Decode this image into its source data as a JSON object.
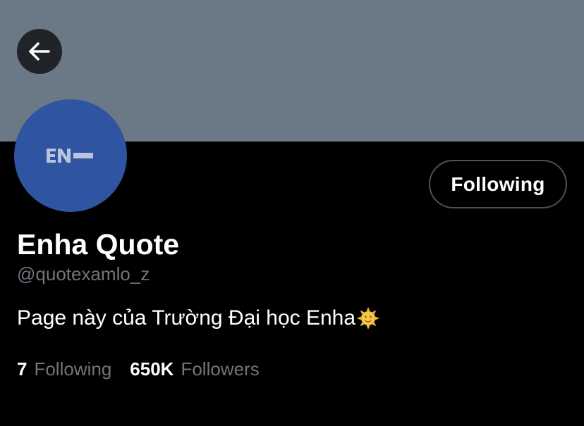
{
  "profile": {
    "display_name": "Enha Quote",
    "handle": "@quotexamlo_z",
    "bio": "Page này của Trường Đại học Enha",
    "bio_emoji": "sun-with-face-icon",
    "avatar_logo": "EN-",
    "follow_button_label": "Following"
  },
  "stats": {
    "following_count": "7",
    "following_label": "Following",
    "followers_count": "650K",
    "followers_label": "Followers"
  },
  "colors": {
    "banner": "#6b7886",
    "background": "#000000",
    "avatar": "#2f55a2",
    "secondary_text": "#6e767d",
    "button_border": "#4a5159"
  },
  "icons": {
    "back": "arrow-left-icon"
  }
}
